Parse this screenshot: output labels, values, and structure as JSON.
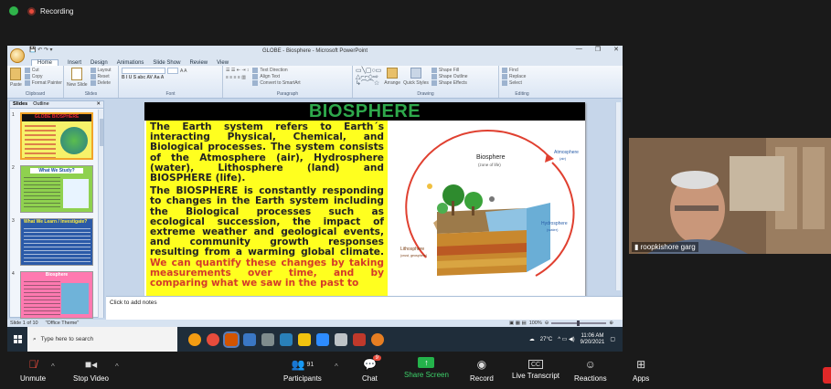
{
  "zoom_top": {
    "recording_label": "Recording"
  },
  "ppt": {
    "window_title": "GLOBE - Biosphere - Microsoft PowerPoint",
    "tabs": [
      "Home",
      "Insert",
      "Design",
      "Animations",
      "Slide Show",
      "Review",
      "View"
    ],
    "ribbon": {
      "clipboard": {
        "label": "Clipboard",
        "paste": "Paste",
        "cut": "Cut",
        "copy": "Copy",
        "format_painter": "Format Painter"
      },
      "slides": {
        "label": "Slides",
        "new_slide": "New Slide",
        "layout": "Layout",
        "reset": "Reset",
        "delete": "Delete"
      },
      "font": {
        "label": "Font"
      },
      "paragraph": {
        "label": "Paragraph",
        "text_direction": "Text Direction",
        "align_text": "Align Text",
        "convert_smartart": "Convert to SmartArt"
      },
      "drawing": {
        "label": "Drawing",
        "arrange": "Arrange",
        "quick_styles": "Quick Styles",
        "shape_fill": "Shape Fill",
        "shape_outline": "Shape Outline",
        "shape_effects": "Shape Effects"
      },
      "editing": {
        "label": "Editing",
        "find": "Find",
        "replace": "Replace",
        "select": "Select"
      }
    },
    "panel_tabs": [
      "Slides",
      "Outline"
    ],
    "thumbnails": [
      {
        "num": "1",
        "title": "GLOBE BIOSPHERE"
      },
      {
        "num": "2",
        "title": "What We Study?"
      },
      {
        "num": "3",
        "title": "What We Learn / Investigate?"
      },
      {
        "num": "4",
        "title": "Biosphere"
      }
    ],
    "slide": {
      "title": "BIOSPHERE",
      "para1": "The Earth system refers to Earth´s interacting Physical, Chemical, and Biological processes. The system consists of the Atmosphere (air), Hydrosphere (water), Lithosphere (land) and BIOSPHERE (life).",
      "para2_black": "The BIOSPHERE is constantly responding to changes in the Earth system including the Biological processes such as ecological succession, the impact of extreme weather and geological events, and community growth responses resulting from a warming global climate.",
      "para2_red": "We can quantify these changes by taking measurements over time, and by comparing what we saw in the past to",
      "diagram": {
        "biosphere": "Biosphere",
        "biosphere_sub": "(zone of life)",
        "atmosphere": "Atmosphere",
        "atmosphere_sub": "(air)",
        "hydrosphere": "Hydrosphere",
        "hydrosphere_sub": "(water)",
        "lithosphere": "Lithosphere",
        "lithosphere_sub": "(crust, geosphere)"
      }
    },
    "notes_placeholder": "Click to add notes",
    "status": {
      "slide_info": "Slide 1 of 10",
      "theme": "\"Office Theme\"",
      "zoom": "100%"
    }
  },
  "taskbar": {
    "search_placeholder": "Type here to search",
    "temperature": "27°C",
    "time": "11:06 AM",
    "date": "9/20/2021"
  },
  "video": {
    "participant_name": "roopkishore garg"
  },
  "zoom_controls": {
    "unmute": "Unmute",
    "stop_video": "Stop Video",
    "participants": "Participants",
    "participants_count": "91",
    "chat": "Chat",
    "chat_badge": "9",
    "share_screen": "Share Screen",
    "record": "Record",
    "live_transcript": "Live Transcript",
    "reactions": "Reactions",
    "apps": "Apps"
  },
  "colors": {
    "slide_title_green": "#2ea84b",
    "textbox_yellow": "#ffff1f",
    "share_green": "#24b34b",
    "record_red": "#e94b3c"
  }
}
